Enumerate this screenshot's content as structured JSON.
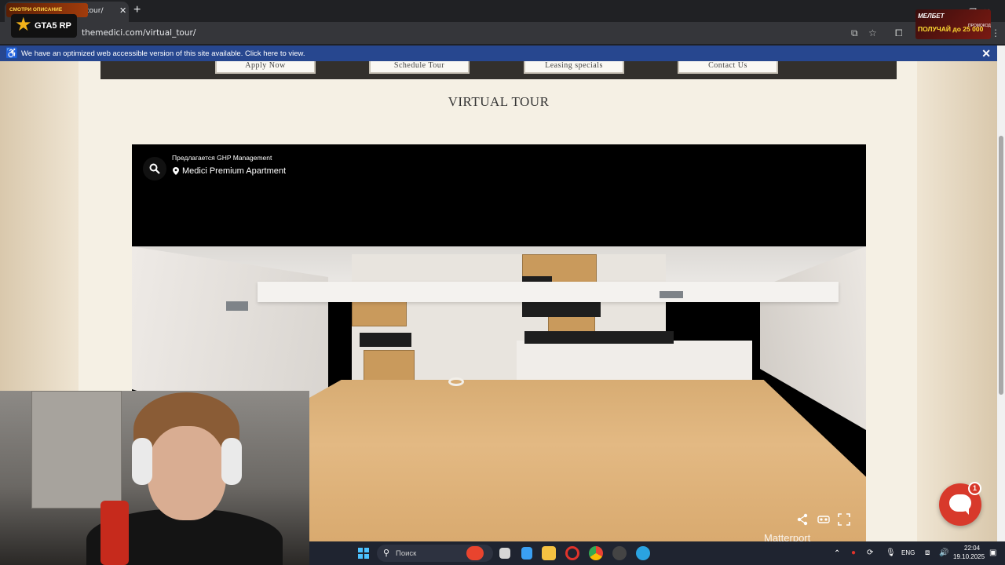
{
  "browser": {
    "tab_title": "tour/",
    "url": "themedici.com/virtual_tour/",
    "promo_text": "СМОТРИ ОПИСАНИЕ",
    "gta_logo": "GTA5 RP",
    "mel_ad": {
      "brand": "МЕЛБЕТ",
      "promo": "ПОЛУЧАЙ до 25 000",
      "small": "ПРОМОКОД"
    }
  },
  "accessibility_banner": {
    "text": "We have an optimized web accessible version of this site available. Click here to view."
  },
  "nav": {
    "items": [
      "Apply Now",
      "Schedule Tour",
      "Leasing specials",
      "Contact Us"
    ]
  },
  "page": {
    "title": "VIRTUAL TOUR"
  },
  "tour": {
    "presented_by": "Предлагается GHP Management",
    "property_name": "Medici Premium Apartment",
    "brand_mark": "Matterport"
  },
  "chat": {
    "badge_count": "1"
  },
  "taskbar": {
    "search_placeholder": "Поиск",
    "language": "ENG",
    "time": "22:04",
    "date": "19.10.2025"
  },
  "colors": {
    "accessibility_bar": "#27478f",
    "chat_button": "#d8392b",
    "page_background": "#f5f0e4",
    "navbar": "#33302c"
  }
}
